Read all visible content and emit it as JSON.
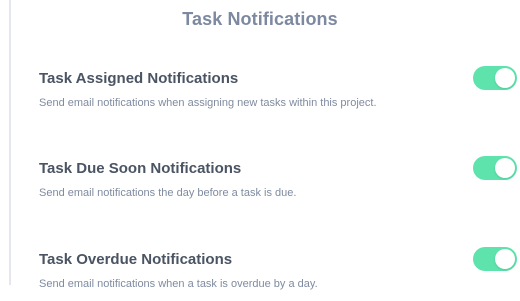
{
  "page": {
    "title": "Task Notifications"
  },
  "settings": [
    {
      "title": "Task Assigned Notifications",
      "description": "Send email notifications when assigning new tasks within this project.",
      "enabled": true
    },
    {
      "title": "Task Due Soon Notifications",
      "description": "Send email notifications the day before a task is due.",
      "enabled": true
    },
    {
      "title": "Task Overdue Notifications",
      "description": "Send email notifications when a task is overdue by a day.",
      "enabled": true
    }
  ],
  "colors": {
    "toggle_on": "#5ee3ad",
    "title_text": "#4a5463",
    "description_text": "#7f8ba0",
    "header_text": "#7c89a0"
  }
}
